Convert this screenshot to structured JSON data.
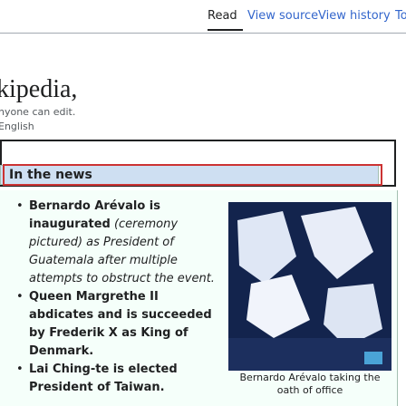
{
  "nav": {
    "tabs": [
      "Read",
      "View source",
      "View history",
      "Tools"
    ],
    "tools_chevron": "chevron-down-icon"
  },
  "brand": {
    "wordmark": "kipedia,",
    "tagline": "nyone can edit.",
    "language": "English"
  },
  "news": {
    "heading": "In the news",
    "items": [
      {
        "lead": "Bernardo Arévalo is inaugurated",
        "rest": " (ceremony pictured) as President of Guatemala after multiple attempts to obstruct the event."
      },
      {
        "lead": "Queen Margrethe II abdicates and is succeeded by Frederik X as King of Denmark.",
        "rest": ""
      },
      {
        "lead": "Lai Ching-te is elected President of Taiwan.",
        "rest": ""
      }
    ],
    "photo_caption": "Bernardo Arévalo taking the oath of office"
  },
  "colors": {
    "link": "#3366cc",
    "header_bg": "#cedff2",
    "content_bg": "#f5fffa",
    "focus": "#cc3333"
  }
}
